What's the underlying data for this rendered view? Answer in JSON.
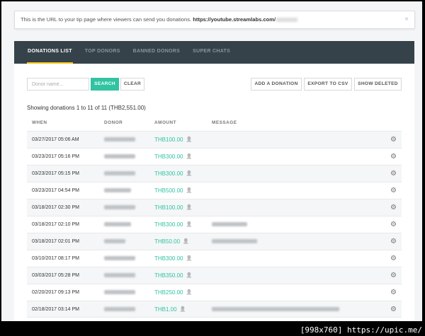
{
  "notice": {
    "text": "This is the URL to your tip page where viewers can send you donations. ",
    "url": "https://youtube.streamlabs.com/",
    "close_icon": "×"
  },
  "tabs": [
    {
      "label": "DONATIONS LIST",
      "active": true
    },
    {
      "label": "TOP DONORS",
      "active": false
    },
    {
      "label": "BANNED DONORS",
      "active": false
    },
    {
      "label": "SUPER CHATS",
      "active": false
    }
  ],
  "search": {
    "placeholder": "Donor name...",
    "search_label": "SEARCH",
    "clear_label": "CLEAR"
  },
  "actions": {
    "add_label": "ADD A DONATION",
    "export_label": "EXPORT TO CSV",
    "deleted_label": "SHOW DELETED"
  },
  "summary": "Showing donations 1 to 11 of 11 (THB2,551.00)",
  "columns": {
    "when": "WHEN",
    "donor": "DONOR",
    "amount": "AMOUNT",
    "message": "MESSAGE"
  },
  "rows": [
    {
      "when": "03/27/2017 05:06 AM",
      "amount": "THB100.00",
      "donor_w": 44,
      "msg_w": 0
    },
    {
      "when": "03/23/2017 05:16 PM",
      "amount": "THB300.00",
      "donor_w": 44,
      "msg_w": 0
    },
    {
      "when": "03/23/2017 05:15 PM",
      "amount": "THB300.00",
      "donor_w": 44,
      "msg_w": 0
    },
    {
      "when": "03/23/2017 04:54 PM",
      "amount": "THB500.00",
      "donor_w": 38,
      "msg_w": 0
    },
    {
      "when": "03/18/2017 02:30 PM",
      "amount": "THB100.00",
      "donor_w": 44,
      "msg_w": 0
    },
    {
      "when": "03/18/2017 02:10 PM",
      "amount": "THB300.00",
      "donor_w": 38,
      "msg_w": 50
    },
    {
      "when": "03/18/2017 02:01 PM",
      "amount": "THB50.00",
      "donor_w": 30,
      "msg_w": 64
    },
    {
      "when": "03/10/2017 08:17 PM",
      "amount": "THB300.00",
      "donor_w": 44,
      "msg_w": 0
    },
    {
      "when": "03/03/2017 05:28 PM",
      "amount": "THB350.00",
      "donor_w": 44,
      "msg_w": 0
    },
    {
      "when": "02/20/2017 09:13 PM",
      "amount": "THB250.00",
      "donor_w": 44,
      "msg_w": 0
    },
    {
      "when": "02/18/2017 03:14 PM",
      "amount": "THB1.00",
      "donor_w": 44,
      "msg_w": 180
    }
  ],
  "watermark": "[998x760] https://upic.me/"
}
